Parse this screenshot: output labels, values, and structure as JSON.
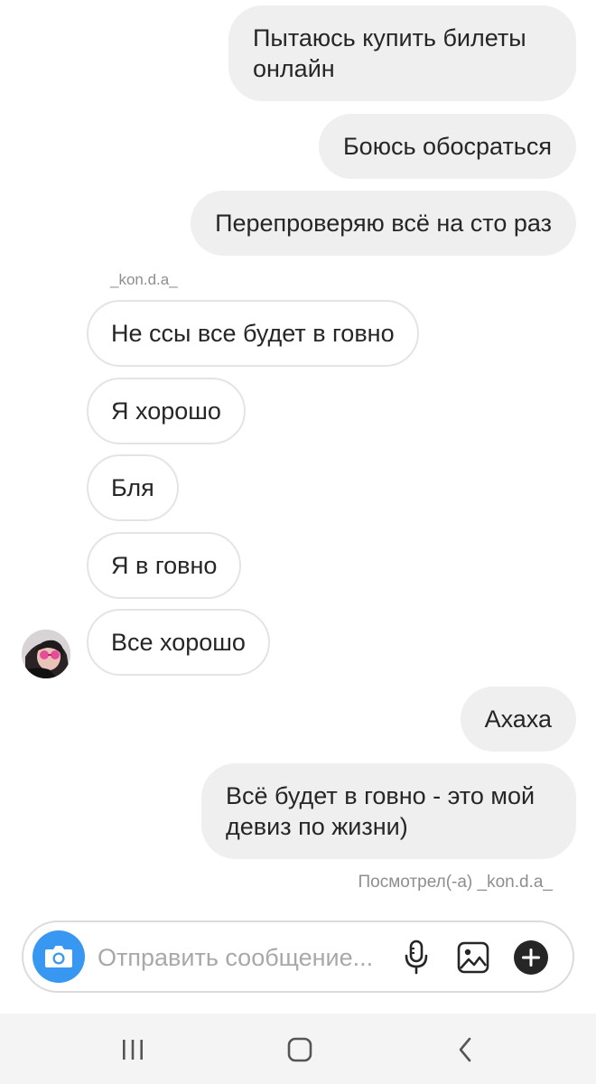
{
  "thread": {
    "sender_name": "_kon.d.a_",
    "seen_status": "Посмотрел(-а) _kon.d.a_",
    "messages": [
      {
        "direction": "outgoing",
        "text": "Пытаюсь купить билеты онлайн"
      },
      {
        "direction": "outgoing",
        "text": "Боюсь обосраться"
      },
      {
        "direction": "outgoing",
        "text": "Перепроверяю всё на сто раз"
      },
      {
        "direction": "incoming",
        "text": "Не ссы все будет в говно"
      },
      {
        "direction": "incoming",
        "text": "Я хорошо"
      },
      {
        "direction": "incoming",
        "text": "Бля"
      },
      {
        "direction": "incoming",
        "text": "Я в говно"
      },
      {
        "direction": "incoming",
        "text": "Все хорошо"
      },
      {
        "direction": "outgoing",
        "text": "Ахаха"
      },
      {
        "direction": "outgoing",
        "text": "Всё будет в говно - это мой девиз по жизни)"
      }
    ]
  },
  "composer": {
    "placeholder": "Отправить сообщение...",
    "icons": [
      "camera-icon",
      "microphone-icon",
      "gallery-icon",
      "plus-icon"
    ]
  },
  "navbar": {
    "icons": [
      "recent-apps-icon",
      "home-icon",
      "back-icon"
    ]
  },
  "colors": {
    "accent": "#3897f0",
    "outgoing_bubble": "#efefef",
    "incoming_border": "#e4e4e4",
    "secondary_text": "#8e8e8e"
  }
}
